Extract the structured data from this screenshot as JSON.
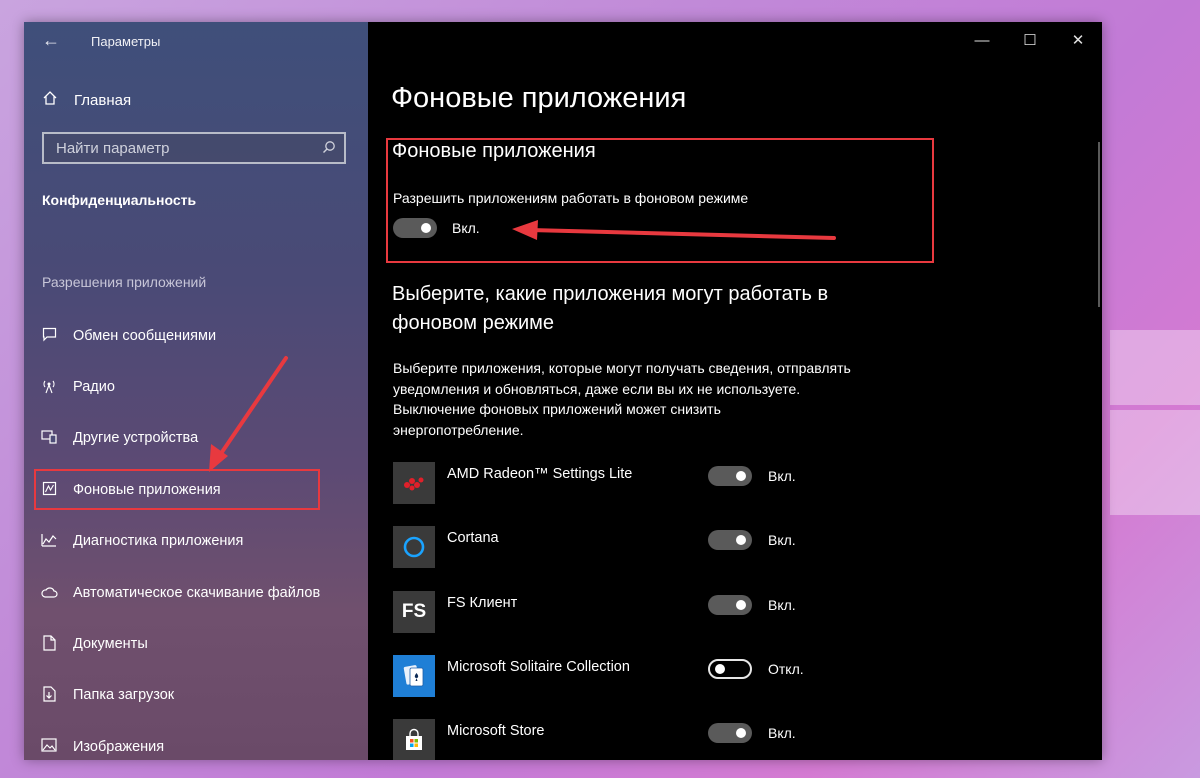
{
  "window": {
    "title": "Параметры"
  },
  "caption": {
    "minimize": "—",
    "maximize": "☐",
    "close": "✕"
  },
  "sidebar": {
    "home_label": "Главная",
    "search_placeholder": "Найти параметр",
    "section_title": "Конфиденциальность",
    "group_title": "Разрешения приложений",
    "items": [
      {
        "label": "Обмен сообщениями",
        "icon": "message-icon"
      },
      {
        "label": "Радио",
        "icon": "radio-icon"
      },
      {
        "label": "Другие устройства",
        "icon": "devices-icon"
      },
      {
        "label": "Фоновые приложения",
        "icon": "background-apps-icon",
        "selected": true
      },
      {
        "label": "Диагностика приложения",
        "icon": "diagnostics-icon"
      },
      {
        "label": "Автоматическое скачивание файлов",
        "icon": "cloud-icon"
      },
      {
        "label": "Документы",
        "icon": "document-icon"
      },
      {
        "label": "Папка загрузок",
        "icon": "downloads-icon"
      },
      {
        "label": "Изображения",
        "icon": "image-icon"
      }
    ]
  },
  "main": {
    "page_title": "Фоновые приложения",
    "sub_title": "Фоновые приложения",
    "allow_text": "Разрешить приложениям работать в фоновом режиме",
    "allow_toggle": {
      "state": "on",
      "label": "Вкл."
    },
    "choose_heading": "Выберите, какие приложения могут работать в фоновом режиме",
    "description": "Выберите приложения, которые могут получать сведения, отправлять уведомления и обновляться, даже если вы их не используете. Выключение фоновых приложений может снизить энергопотребление.",
    "apps": [
      {
        "name": "AMD Radeon™ Settings Lite",
        "state": "on",
        "label": "Вкл.",
        "icon": "amd-radeon-icon"
      },
      {
        "name": "Cortana",
        "state": "on",
        "label": "Вкл.",
        "icon": "cortana-icon"
      },
      {
        "name": "FS Клиент",
        "state": "on",
        "label": "Вкл.",
        "icon": "fs-client-icon",
        "icon_text": "FS"
      },
      {
        "name": "Microsoft Solitaire Collection",
        "state": "off",
        "label": "Откл.",
        "icon": "solitaire-icon"
      },
      {
        "name": "Microsoft Store",
        "state": "on",
        "label": "Вкл.",
        "icon": "store-icon"
      }
    ]
  },
  "colors": {
    "highlight": "#e8393f",
    "accent": "#0078d7",
    "cortana": "#1aa3ff"
  }
}
